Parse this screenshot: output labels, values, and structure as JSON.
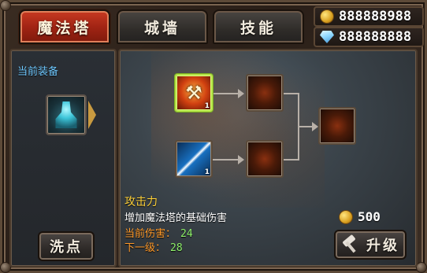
{
  "tabs": [
    {
      "label": "魔法塔",
      "active": true
    },
    {
      "label": "城墙",
      "active": false
    },
    {
      "label": "技能",
      "active": false
    }
  ],
  "currency": {
    "gold": "888888988",
    "gems": "888888888",
    "gold_icon": "gold-coin-icon",
    "gem_icon": "diamond-icon"
  },
  "left_panel": {
    "equip_label": "当前装备",
    "equipped_icon": "magic-tower-icon",
    "reset_button": "洗点"
  },
  "skill_tree": {
    "nodes": [
      {
        "name": "axe-skill",
        "level": "1",
        "icon": "fire-axe-icon",
        "selected": true
      },
      {
        "name": "lightning-skill",
        "level": "1",
        "icon": "lightning-icon",
        "selected": false
      },
      {
        "name": "locked-skill-1",
        "icon": "locked-skill-icon"
      },
      {
        "name": "locked-skill-2",
        "icon": "locked-skill-icon"
      },
      {
        "name": "locked-skill-final",
        "icon": "locked-skill-icon"
      }
    ]
  },
  "detail": {
    "skill_name": "攻击力",
    "description": "增加魔法塔的基础伤害",
    "current_label": "当前伤害：",
    "current_value": "24",
    "next_label": "下一级：",
    "next_value": "28"
  },
  "upgrade": {
    "cost": "500",
    "button_label": "升级",
    "button_icon": "hammer-icon"
  },
  "colors": {
    "active_tab": "#b02a16",
    "highlight_text": "#ffd23a",
    "stat_label": "#ff9a2a",
    "stat_value": "#8ef06a",
    "equip_label": "#6fc8ff",
    "selected_border": "#b6e34a"
  }
}
